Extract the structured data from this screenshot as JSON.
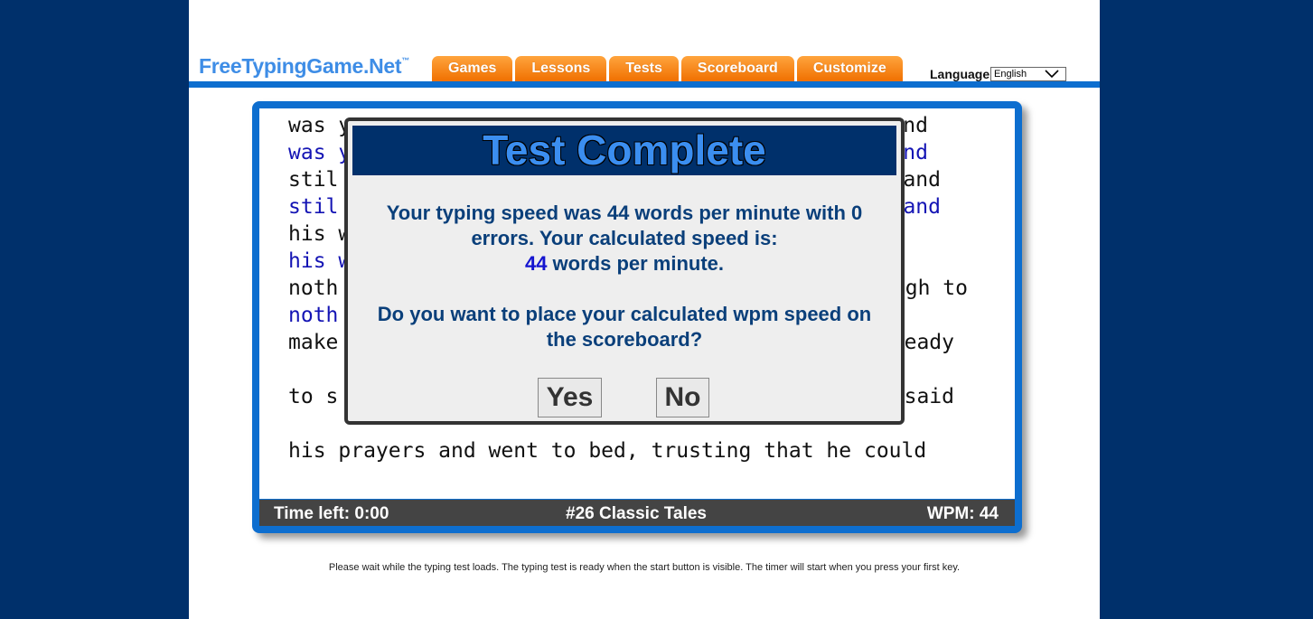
{
  "logo": {
    "text": "FreeTypingGame.Net",
    "tm": "™"
  },
  "nav": {
    "tabs": [
      "Games",
      "Lessons",
      "Tests",
      "Scoreboard",
      "Customize"
    ]
  },
  "language": {
    "label": "Language",
    "selected": "English"
  },
  "typing_lines": [
    {
      "text": "was y",
      "typed": false,
      "right": "nd"
    },
    {
      "text": "was y",
      "typed": true,
      "right": "nd"
    },
    {
      "text": "stil",
      "typed": false,
      "right": "and"
    },
    {
      "text": "stil",
      "typed": true,
      "right": "and"
    },
    {
      "text": "his w",
      "typed": false,
      "right": ""
    },
    {
      "text": "his w",
      "typed": true,
      "right": ""
    },
    {
      "text": "noth",
      "typed": false,
      "right": "gh to"
    },
    {
      "text": "noth",
      "typed": true,
      "right": ""
    },
    {
      "text": "make",
      "typed": false,
      "right": "eady"
    },
    {
      "text": "to s",
      "typed": false,
      "right": "said"
    },
    {
      "text": "his prayers and went to bed, trusting that he could",
      "typed": false,
      "right": ""
    }
  ],
  "status": {
    "time_left": "Time left: 0:00",
    "test_name": "#26 Classic Tales",
    "wpm": "WPM: 44"
  },
  "modal": {
    "title": "Test Complete",
    "line1": "Your typing speed was 44 words per minute with 0",
    "line2": "errors. Your calculated speed is:",
    "calc_wpm": "44",
    "calc_suffix": " words per minute.",
    "question1": "Do you want to place your calculated wpm speed on",
    "question2": "the scoreboard?",
    "yes": "Yes",
    "no": "No"
  },
  "footer": "Please wait while the typing test loads. The typing test is ready when the start button is visible. The timer will start when you press your first key.",
  "colors": {
    "background": "#00306b",
    "accent_blue": "#0d6ecf",
    "tab_orange": "#f07000",
    "typed_text": "#1414b4"
  }
}
